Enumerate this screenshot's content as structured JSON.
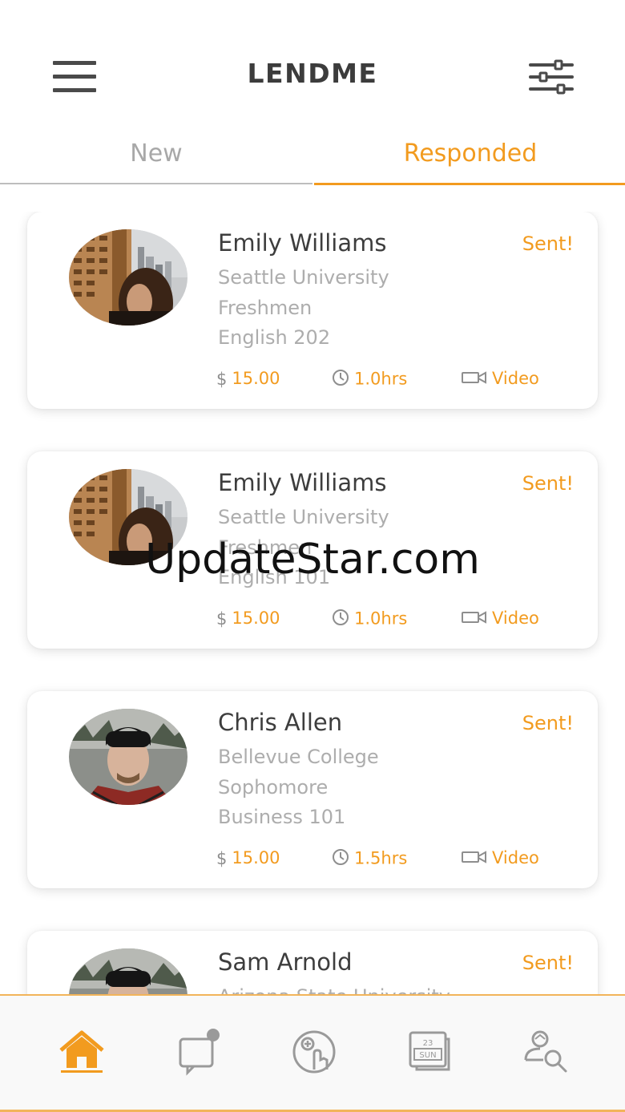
{
  "header": {
    "title": "LENDME",
    "menu_icon": "hamburger-menu-icon",
    "filter_icon": "sliders-icon"
  },
  "tabs": [
    {
      "label": "New",
      "active": false
    },
    {
      "label": "Responded",
      "active": true
    }
  ],
  "colors": {
    "accent": "#f29b1f",
    "muted_text": "#adadad",
    "dark_text": "#3d3d3d"
  },
  "requests": [
    {
      "name": "Emily Williams",
      "status": "Sent!",
      "school": "Seattle University",
      "year": "Freshmen",
      "course": "English 202",
      "price": "15.00",
      "currency": "$",
      "duration": "1.0hrs",
      "mode": "Video"
    },
    {
      "name": "Emily Williams",
      "status": "Sent!",
      "school": "Seattle University",
      "year": "Freshmen",
      "course": "English 101",
      "price": "15.00",
      "currency": "$",
      "duration": "1.0hrs",
      "mode": "Video"
    },
    {
      "name": "Chris Allen",
      "status": "Sent!",
      "school": "Bellevue College",
      "year": "Sophomore",
      "course": "Business 101",
      "price": "15.00",
      "currency": "$",
      "duration": "1.5hrs",
      "mode": "Video"
    },
    {
      "name": "Sam Arnold",
      "status": "Sent!",
      "school": "Arizona State University",
      "year": "",
      "course": "",
      "price": "",
      "currency": "",
      "duration": "",
      "mode": ""
    }
  ],
  "watermark": "UpdateStar.com",
  "calendar_icon": {
    "day_number": "23",
    "day_name": "SUN"
  },
  "bottom_nav": [
    {
      "icon": "home-icon",
      "active": true
    },
    {
      "icon": "chat-icon",
      "active": false
    },
    {
      "icon": "add-request-icon",
      "active": false
    },
    {
      "icon": "calendar-icon",
      "active": false
    },
    {
      "icon": "tutor-search-icon",
      "active": false
    }
  ]
}
